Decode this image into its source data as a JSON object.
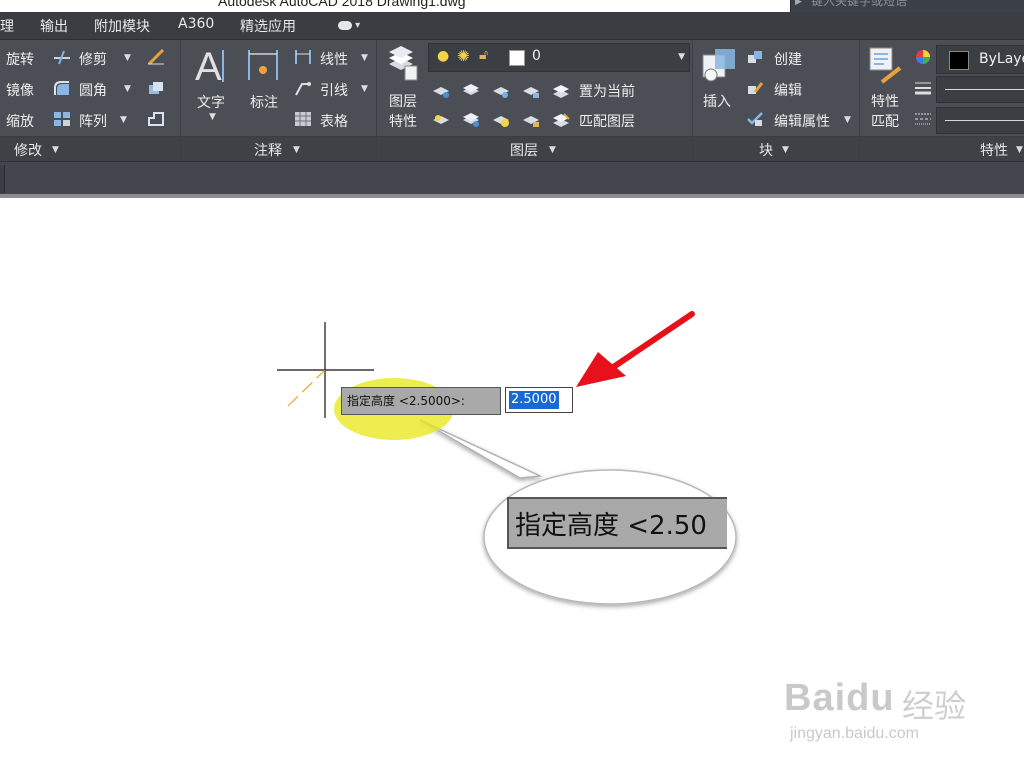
{
  "window": {
    "title": "Autodesk AutoCAD 2018    Drawing1.dwg",
    "search_hint": "键入关键字或短语"
  },
  "tabs": [
    "理",
    "输出",
    "附加模块",
    "A360",
    "精选应用"
  ],
  "ribbon": {
    "modify": {
      "title": "修改",
      "tools": [
        "旋转",
        "镜像",
        "缩放",
        "修剪",
        "圆角",
        "阵列"
      ]
    },
    "annotation": {
      "title": "注释",
      "big": [
        "文字",
        "标注"
      ],
      "tools": [
        "线性",
        "引线",
        "表格"
      ]
    },
    "layers": {
      "title": "图层",
      "big": [
        "图层",
        "特性"
      ],
      "current_layer": "0",
      "tools": [
        "置为当前",
        "匹配图层"
      ]
    },
    "block": {
      "title": "块",
      "big": "插入",
      "tools": [
        "创建",
        "编辑",
        "编辑属性"
      ]
    },
    "properties": {
      "title": "特性",
      "big": [
        "特性",
        "匹配"
      ],
      "color_value": "ByLayer"
    }
  },
  "drawing": {
    "prompt": "指定高度 <2.5000>:",
    "input_value": "2.5000",
    "zoom_text": "指定高度 <2.50"
  },
  "watermark": {
    "logo": "Baidu",
    "cn": "经验",
    "url": "jingyan.baidu.com"
  },
  "colors": {
    "ribbon_bg": "#4b4f55",
    "tab_bg": "#3a3d42",
    "highlight": "#e8e81e",
    "arrow": "#e8101a",
    "selection": "#1769d6"
  }
}
